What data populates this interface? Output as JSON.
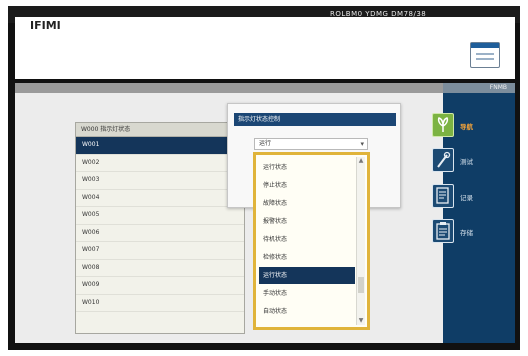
{
  "app": {
    "title": "IFIMI",
    "title_bar_text": "ROLBM0 YDMG DM78/38",
    "toolbar_icon": "window-icon"
  },
  "nav": {
    "header_label": "FNMB",
    "items": [
      {
        "label": "导航",
        "icon": "leaf-icon"
      },
      {
        "label": "测试",
        "icon": "wrench-icon"
      },
      {
        "label": "记录",
        "icon": "document-icon"
      },
      {
        "label": "存储",
        "icon": "clipboard-icon"
      }
    ]
  },
  "list": {
    "header": "W000 指示灯状态",
    "rows": [
      "W001",
      "W002",
      "W003",
      "W004",
      "W005",
      "W006",
      "W007",
      "W008",
      "W009",
      "W010"
    ],
    "selected_index": 0
  },
  "dialog": {
    "title": "指示灯状态控制",
    "selected_value": "运行",
    "options": [
      "运行状态",
      "停止状态",
      "故障状态",
      "报警状态",
      "待机状态",
      "检修状态",
      "运行状态",
      "手动状态",
      "自动状态"
    ],
    "selected_option_index": 6
  },
  "colors": {
    "accent": "#f2a33a",
    "sidebar": "#0f3d66",
    "selection": "#14355a",
    "highlight_border": "#e0b43a"
  }
}
